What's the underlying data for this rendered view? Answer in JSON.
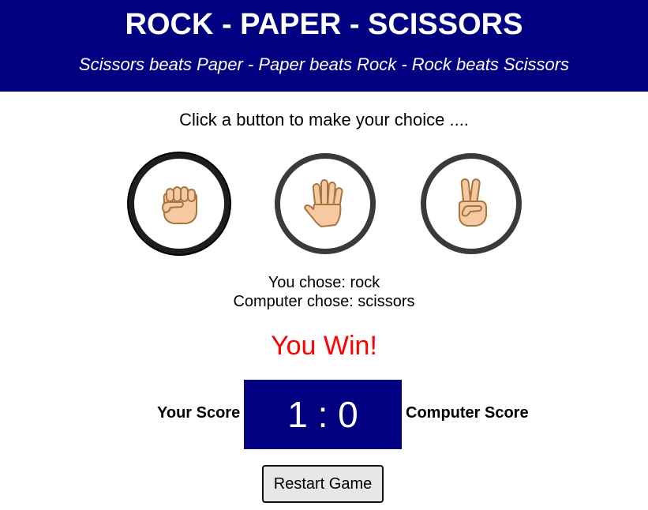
{
  "header": {
    "title": "ROCK - PAPER - SCISSORS",
    "subtitle": "Scissors beats Paper - Paper beats Rock - Rock beats Scissors"
  },
  "prompt": "Click a button to make your choice ....",
  "choices": [
    {
      "id": "rock",
      "icon": "fist-icon",
      "selected": true
    },
    {
      "id": "paper",
      "icon": "open-hand-icon",
      "selected": false
    },
    {
      "id": "scissors",
      "icon": "victory-hand-icon",
      "selected": false
    }
  ],
  "result": {
    "you_chose": "You chose: rock",
    "computer_chose": "Computer chose: scissors",
    "outcome": "You Win!"
  },
  "score": {
    "your_label": "Your Score",
    "computer_label": "Computer Score",
    "display": "1 : 0",
    "player": 1,
    "computer": 0
  },
  "restart_label": "Restart Game",
  "colors": {
    "header_bg": "#000080",
    "outcome": "#ff0000",
    "skin": "#f7c9a2",
    "skin_outline": "#a8743f"
  }
}
